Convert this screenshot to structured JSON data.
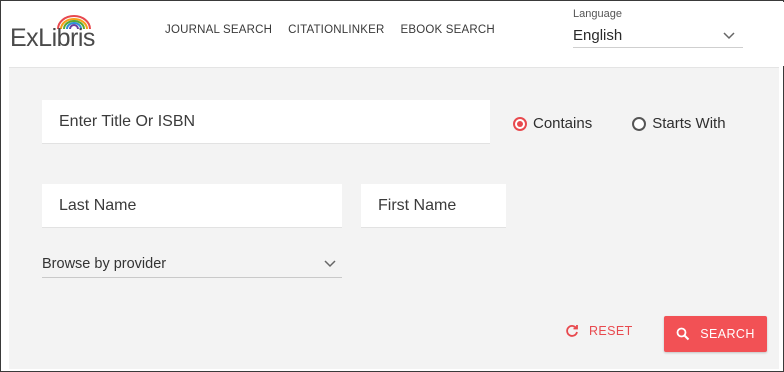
{
  "brand": {
    "logo_text": "ExLibris"
  },
  "nav": {
    "items": [
      {
        "label": "JOURNAL SEARCH"
      },
      {
        "label": "CITATIONLINKER"
      },
      {
        "label": "EBOOK SEARCH"
      }
    ]
  },
  "language": {
    "label": "Language",
    "selected": "English"
  },
  "form": {
    "title_isbn": {
      "placeholder": "Enter Title Or ISBN",
      "value": ""
    },
    "match_options": [
      {
        "label": "Contains",
        "checked": true
      },
      {
        "label": "Starts With",
        "checked": false
      }
    ],
    "last_name": {
      "placeholder": "Last Name",
      "value": ""
    },
    "first_name": {
      "placeholder": "First Name",
      "value": ""
    },
    "browse": {
      "selected": "Browse by provider"
    }
  },
  "actions": {
    "reset_label": "RESET",
    "search_label": "SEARCH"
  },
  "colors": {
    "accent": "#f25155",
    "panel_bg": "#f3f3f3",
    "text": "#333333"
  },
  "icons": {
    "language_chevron": "chevron-down-icon",
    "reset": "refresh-icon",
    "search": "search-icon"
  }
}
